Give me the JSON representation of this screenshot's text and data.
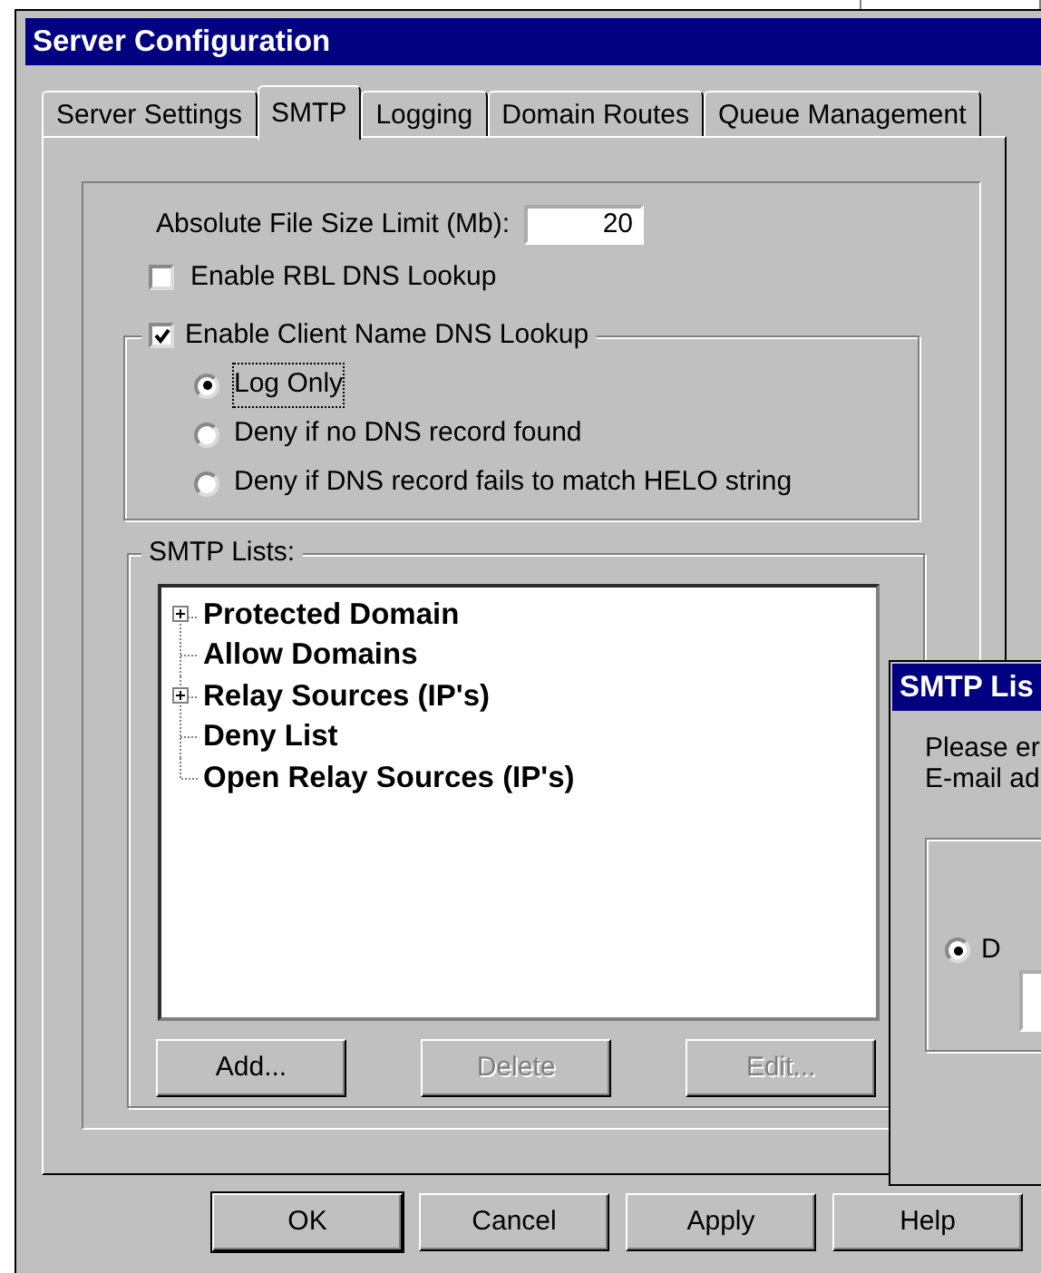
{
  "window": {
    "title": "Server Configuration"
  },
  "tabs": [
    {
      "label": "Server Settings",
      "selected": false
    },
    {
      "label": "SMTP",
      "selected": true
    },
    {
      "label": "Logging",
      "selected": false
    },
    {
      "label": "Domain Routes",
      "selected": false
    },
    {
      "label": "Queue Management",
      "selected": false
    }
  ],
  "file_size_limit": {
    "label": "Absolute File Size Limit (Mb):",
    "value": "20"
  },
  "rbl_lookup": {
    "label": "Enable RBL DNS Lookup",
    "checked": false
  },
  "client_name_lookup": {
    "label": "Enable Client Name DNS Lookup",
    "checked": true,
    "options": [
      {
        "label": "Log Only",
        "selected": true
      },
      {
        "label": "Deny if no DNS record found",
        "selected": false
      },
      {
        "label": "Deny if DNS record fails to match HELO string",
        "selected": false
      }
    ]
  },
  "smtp_lists": {
    "label": "SMTP Lists:",
    "items": [
      {
        "label": "Protected Domain",
        "expandable": true
      },
      {
        "label": "Allow Domains",
        "expandable": false
      },
      {
        "label": "Relay Sources (IP's)",
        "expandable": true
      },
      {
        "label": "Deny List",
        "expandable": false
      },
      {
        "label": "Open Relay Sources (IP's)",
        "expandable": false
      }
    ],
    "buttons": [
      {
        "label": "Add...",
        "disabled": false
      },
      {
        "label": "Delete",
        "disabled": true
      },
      {
        "label": "Edit...",
        "disabled": true
      }
    ]
  },
  "buttons": [
    {
      "label": "OK",
      "default": true
    },
    {
      "label": "Cancel",
      "default": false
    },
    {
      "label": "Apply",
      "default": false
    },
    {
      "label": "Help",
      "default": false
    }
  ],
  "dialog": {
    "title": "SMTP Lis",
    "text": [
      "Please er",
      "E-mail ad"
    ],
    "option": {
      "label": "D",
      "selected": true
    }
  }
}
